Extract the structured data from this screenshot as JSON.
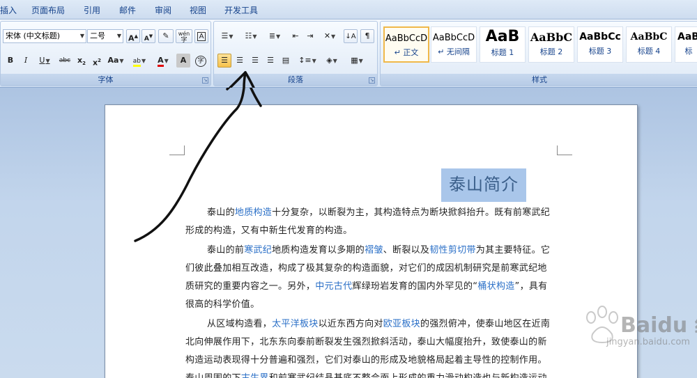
{
  "ribbon_tabs": [
    "插入",
    "页面布局",
    "引用",
    "邮件",
    "审阅",
    "视图",
    "开发工具"
  ],
  "font_group": {
    "label": "字体",
    "font_name": "宋体 (中文标题)",
    "font_size": "二号",
    "grow_font": "A",
    "shrink_font": "A",
    "clear_format": "A",
    "phonetic": "wén",
    "bold": "B",
    "italic": "I",
    "underline": "U",
    "strikethrough": "abc",
    "subscript": "x",
    "superscript": "x",
    "change_case": "Aa",
    "highlight": "ab",
    "font_color": "A",
    "char_shading": "A",
    "enclose": "字"
  },
  "paragraph_group": {
    "label": "段落"
  },
  "styles_group": {
    "label": "样式",
    "styles": [
      {
        "sample": "AaBbCcD",
        "name": "↵ 正文"
      },
      {
        "sample": "AaBbCcD",
        "name": "↵ 无间隔"
      },
      {
        "sample": "AaB",
        "name": "标题 1"
      },
      {
        "sample": "AaBbC",
        "name": "标题 2"
      },
      {
        "sample": "AaBbCc",
        "name": "标题 3"
      },
      {
        "sample": "AaBbC",
        "name": "标题 4"
      },
      {
        "sample": "AaB",
        "name": "标"
      }
    ]
  },
  "document": {
    "title": "泰山简介",
    "paragraphs": [
      [
        {
          "t": "泰山的"
        },
        {
          "t": "地质构造",
          "link": true
        },
        {
          "t": "十分复杂，以断裂为主，其构造特点为断块掀斜抬升。既有前寒武纪形成的构造，又有中新生代发育的构造。"
        }
      ],
      [
        {
          "t": "泰山的前"
        },
        {
          "t": "寒武纪",
          "link": true
        },
        {
          "t": "地质构造发育以多期的"
        },
        {
          "t": "褶皱",
          "link": true
        },
        {
          "t": "、断裂以及"
        },
        {
          "t": "韧性剪切带",
          "link": true
        },
        {
          "t": "为其主要特征。它们彼此叠加相互改造，构成了极其复杂的构造面貌，对它们的成因机制研究是前寒武纪地质研究的重要内容之一。另外，"
        },
        {
          "t": "中元古代",
          "link": true
        },
        {
          "t": "辉绿玢岩发育的国内外罕见的“"
        },
        {
          "t": "桶状构造",
          "link": true
        },
        {
          "t": "”，具有很高的科学价值。"
        }
      ],
      [
        {
          "t": "从区域构造看，"
        },
        {
          "t": "太平洋板块",
          "link": true
        },
        {
          "t": "以近东西方向对"
        },
        {
          "t": "欧亚板块",
          "link": true
        },
        {
          "t": "的强烈俯冲，使泰山地区在近南北向伸展作用下，北东东向泰前断裂发生强烈掀斜活动，泰山大幅度抬升，致使泰山的新构造运动表现得十分普遍和强烈，它们对泰山的形成及地貌格局起着主导性的控制作用。泰山周围的下"
        },
        {
          "t": "古生界",
          "link": true
        },
        {
          "t": "和前寒武纪结晶基底不整合面上形成的重力滑动构造也与新构造运动"
        }
      ]
    ]
  },
  "watermark": {
    "brand": "Baidu 经验",
    "url": "jingyan.baidu.com"
  },
  "colors": {
    "link": "#2a6fc7",
    "title_highlight": "#a9c6ea",
    "active_button": "#f7c14c"
  }
}
